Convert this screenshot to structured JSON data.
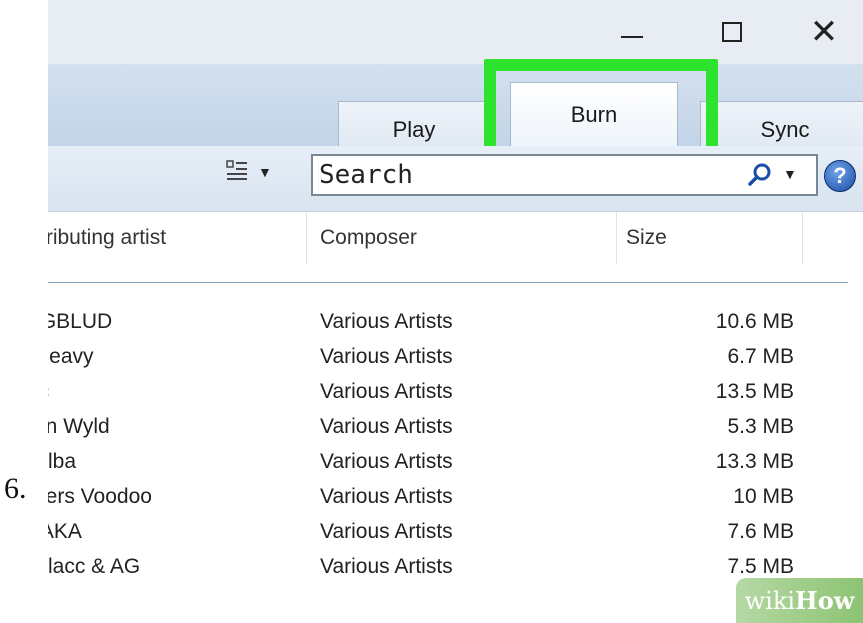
{
  "step_number": "6.",
  "window_controls": {
    "minimize": "minimize-icon",
    "maximize": "maximize-icon",
    "close": "close-icon"
  },
  "tabs": [
    {
      "label": "Play"
    },
    {
      "label": "Burn",
      "highlighted": true
    },
    {
      "label": "Sync"
    }
  ],
  "highlight_color": "#2ee32e",
  "toolbar": {
    "view_options_icon": "view-options-icon",
    "search_placeholder": "Search",
    "search_icon": "search-icon",
    "help_icon": "help-icon"
  },
  "columns": [
    {
      "label": "tributing artist"
    },
    {
      "label": "Composer"
    },
    {
      "label": "Size"
    }
  ],
  "rows": [
    {
      "artist": "IGBLUD",
      "composer": "Various Artists",
      "size": "10.6 MB"
    },
    {
      "artist": "Heavy",
      "composer": "Various Artists",
      "size": "6.7 MB"
    },
    {
      "artist": "ic",
      "composer": "Various Artists",
      "size": "13.5 MB"
    },
    {
      "artist": "on Wyld",
      "composer": "Various Artists",
      "size": "5.3 MB"
    },
    {
      "artist": "Elba",
      "composer": "Various Artists",
      "size": "13.3 MB"
    },
    {
      "artist": "hers Voodoo",
      "composer": "Various Artists",
      "size": "10 MB"
    },
    {
      "artist": "IAKA",
      "composer": "Various Artists",
      "size": "7.6 MB"
    },
    {
      "artist": "Blacc & AG",
      "composer": "Various Artists",
      "size": "7.5 MB"
    }
  ],
  "watermark": {
    "text": "wikiHow",
    "wiki": "wiki",
    "how": "How"
  }
}
